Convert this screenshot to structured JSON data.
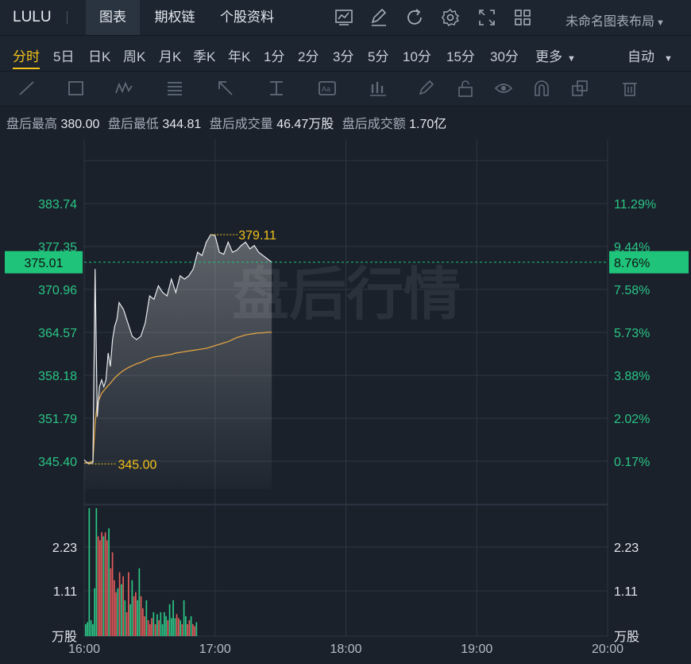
{
  "header": {
    "ticker": "LULU",
    "tabs": [
      "图表",
      "期权链",
      "个股资料"
    ],
    "active_tab": "图表",
    "layout_label": "未命名图表布局",
    "icons": [
      "chart-icon",
      "edit-icon",
      "refresh-icon",
      "settings-icon",
      "fullscreen-icon",
      "grid-layout-icon"
    ]
  },
  "periods": {
    "items": [
      "分时",
      "5日",
      "日K",
      "周K",
      "月K",
      "季K",
      "年K",
      "1分",
      "2分",
      "3分",
      "5分",
      "10分",
      "15分",
      "30分",
      "更多"
    ],
    "active": "分时",
    "mode": "自动"
  },
  "toolbar": {
    "icons": [
      "line-tool-icon",
      "rectangle-tool-icon",
      "pattern-tool-icon",
      "fibonacci-tool-icon",
      "arrow-tool-icon",
      "measure-tool-icon",
      "text-tool-icon",
      "indicator-tool-icon",
      "brush-icon",
      "lock-icon",
      "eye-icon",
      "magnet-icon",
      "layers-icon",
      "trash-icon"
    ]
  },
  "info": {
    "high_label": "盘后最高",
    "high": "380.00",
    "low_label": "盘后最低",
    "low": "344.81",
    "vol_label": "盘后成交量",
    "vol": "46.47万股",
    "amt_label": "盘后成交额",
    "amt": "1.70亿"
  },
  "chart_data": {
    "type": "line",
    "watermark": "盘后行情",
    "x_ticks": [
      "16:00",
      "17:00",
      "18:00",
      "19:00",
      "20:00"
    ],
    "y_left_ticks": [
      "383.74",
      "377.35",
      "370.96",
      "364.57",
      "358.18",
      "351.79",
      "345.40"
    ],
    "y_right_ticks": [
      "11.29%",
      "9.44%",
      "7.58%",
      "5.73%",
      "3.88%",
      "2.02%",
      "0.17%"
    ],
    "ylim": [
      345.4,
      383.74
    ],
    "current_price": "375.01",
    "current_change": "8.76%",
    "high_annotation": "379.11",
    "low_annotation": "345.00",
    "volume_unit": "万股",
    "volume_ticks": [
      "2.23",
      "1.11"
    ],
    "colors": {
      "price": "#e8eaee",
      "avg": "#e0a242",
      "up": "#2bc585",
      "down": "#e25a5a",
      "tag": "#1fc37a",
      "annotation": "#f3c21b"
    },
    "price_series": {
      "name": "",
      "x_minutes": [
        0,
        2,
        4,
        5,
        6,
        7,
        8,
        9,
        10,
        11,
        12,
        13,
        14,
        15,
        16,
        18,
        20,
        22,
        24,
        26,
        28,
        30,
        32,
        34,
        36,
        38,
        40,
        42,
        44,
        46,
        48,
        50,
        52,
        54,
        56,
        58,
        60,
        62,
        64,
        66,
        68,
        70,
        72,
        74,
        76,
        78,
        80,
        82,
        84,
        86
      ],
      "values": [
        345.6,
        345.0,
        345.2,
        374.0,
        352.0,
        356.5,
        357.5,
        356.5,
        357.5,
        361.5,
        359.5,
        363.5,
        365.5,
        366.5,
        369.0,
        368.0,
        366.0,
        364.0,
        363.5,
        364.0,
        366.0,
        370.0,
        369.5,
        371.5,
        370.5,
        370.0,
        372.5,
        370.5,
        373.0,
        372.5,
        373.0,
        374.0,
        376.5,
        376.0,
        378.0,
        379.1,
        379.0,
        376.5,
        376.2,
        378.0,
        376.5,
        376.8,
        377.5,
        378.0,
        377.0,
        377.5,
        376.5,
        376.0,
        375.5,
        375.01
      ]
    },
    "avg_series": {
      "name": "",
      "x_minutes": [
        0,
        2,
        4,
        5,
        6,
        8,
        10,
        12,
        14,
        16,
        18,
        20,
        22,
        24,
        26,
        28,
        30,
        32,
        34,
        36,
        38,
        40,
        42,
        44,
        46,
        48,
        50,
        52,
        54,
        56,
        58,
        60,
        62,
        64,
        66,
        68,
        70,
        72,
        74,
        76,
        78,
        80,
        82,
        84,
        86
      ],
      "values": [
        345.1,
        345.2,
        345.4,
        351.0,
        354.0,
        355.5,
        356.3,
        357.0,
        357.8,
        358.4,
        358.9,
        359.3,
        359.6,
        359.9,
        360.1,
        360.4,
        360.7,
        360.9,
        361.0,
        361.1,
        361.2,
        361.3,
        361.5,
        361.6,
        361.7,
        361.8,
        361.9,
        362.0,
        362.1,
        362.2,
        362.4,
        362.6,
        362.8,
        363.0,
        363.2,
        363.5,
        363.8,
        364.0,
        364.2,
        364.3,
        364.4,
        364.5,
        364.5,
        364.6,
        364.6
      ]
    },
    "volume_series": {
      "max": 2.23,
      "bars": [
        [
          0,
          0.3,
          "up"
        ],
        [
          1,
          0.35,
          "up"
        ],
        [
          2,
          3.9,
          "up"
        ],
        [
          3,
          0.4,
          "up"
        ],
        [
          4,
          0.3,
          "up"
        ],
        [
          5,
          1.2,
          "up"
        ],
        [
          6,
          3.6,
          "up"
        ],
        [
          7,
          2.5,
          "down"
        ],
        [
          8,
          2.4,
          "down"
        ],
        [
          9,
          2.6,
          "down"
        ],
        [
          10,
          2.5,
          "up"
        ],
        [
          11,
          2.6,
          "down"
        ],
        [
          12,
          2.4,
          "down"
        ],
        [
          13,
          2.7,
          "up"
        ],
        [
          14,
          1.7,
          "down"
        ],
        [
          15,
          2.1,
          "down"
        ],
        [
          16,
          1.4,
          "down"
        ],
        [
          17,
          1.1,
          "down"
        ],
        [
          18,
          1.2,
          "up"
        ],
        [
          19,
          1.6,
          "down"
        ],
        [
          20,
          1.3,
          "up"
        ],
        [
          21,
          1.5,
          "down"
        ],
        [
          22,
          0.9,
          "up"
        ],
        [
          23,
          0.6,
          "down"
        ],
        [
          24,
          1.6,
          "down"
        ],
        [
          25,
          0.8,
          "up"
        ],
        [
          26,
          1.4,
          "up"
        ],
        [
          27,
          1.0,
          "down"
        ],
        [
          28,
          1.1,
          "down"
        ],
        [
          29,
          0.9,
          "up"
        ],
        [
          30,
          1.7,
          "up"
        ],
        [
          31,
          1.0,
          "down"
        ],
        [
          32,
          0.7,
          "down"
        ],
        [
          33,
          0.5,
          "down"
        ],
        [
          34,
          0.9,
          "up"
        ],
        [
          35,
          0.4,
          "down"
        ],
        [
          36,
          0.3,
          "down"
        ],
        [
          37,
          0.45,
          "down"
        ],
        [
          38,
          0.6,
          "up"
        ],
        [
          39,
          0.3,
          "down"
        ],
        [
          40,
          0.55,
          "up"
        ],
        [
          41,
          0.4,
          "down"
        ],
        [
          42,
          0.6,
          "up"
        ],
        [
          43,
          0.3,
          "up"
        ],
        [
          44,
          0.6,
          "up"
        ],
        [
          45,
          0.5,
          "up"
        ],
        [
          46,
          0.4,
          "down"
        ],
        [
          47,
          0.8,
          "up"
        ],
        [
          48,
          0.45,
          "up"
        ],
        [
          49,
          0.9,
          "up"
        ],
        [
          50,
          0.45,
          "up"
        ],
        [
          51,
          0.55,
          "down"
        ],
        [
          52,
          0.45,
          "down"
        ],
        [
          53,
          0.4,
          "up"
        ],
        [
          54,
          0.3,
          "down"
        ],
        [
          55,
          0.9,
          "up"
        ],
        [
          56,
          0.5,
          "up"
        ],
        [
          57,
          0.3,
          "down"
        ],
        [
          58,
          0.4,
          "down"
        ],
        [
          59,
          0.5,
          "up"
        ],
        [
          60,
          0.3,
          "down"
        ],
        [
          61,
          0.25,
          "down"
        ],
        [
          62,
          0.35,
          "up"
        ]
      ]
    }
  }
}
